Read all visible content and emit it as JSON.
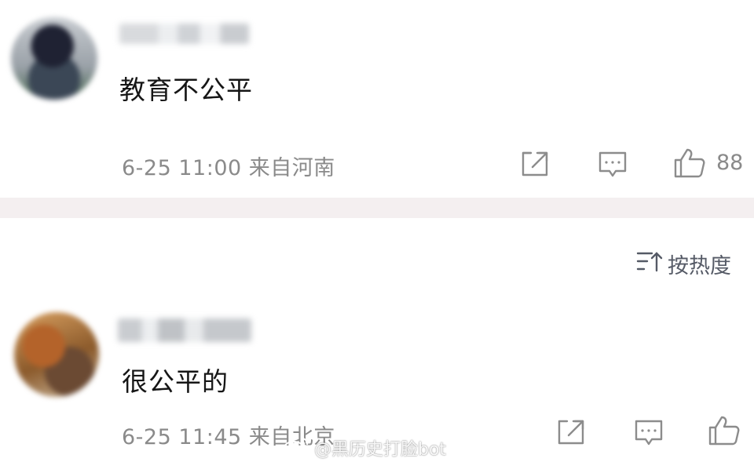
{
  "comments": [
    {
      "text": "教育不公平",
      "meta": "6-25 11:00 来自河南",
      "likes": "88"
    },
    {
      "text": "很公平的",
      "meta": "6-25 11:45 来自北京",
      "likes": ""
    }
  ],
  "sort": {
    "label": "按热度"
  },
  "watermark": {
    "text": "@黑历史打脸bot"
  },
  "icons": {
    "share": "share-icon",
    "comment": "comment-icon",
    "like": "thumbs-up-icon",
    "sort": "sort-icon",
    "weibo": "weibo-logo-icon"
  }
}
